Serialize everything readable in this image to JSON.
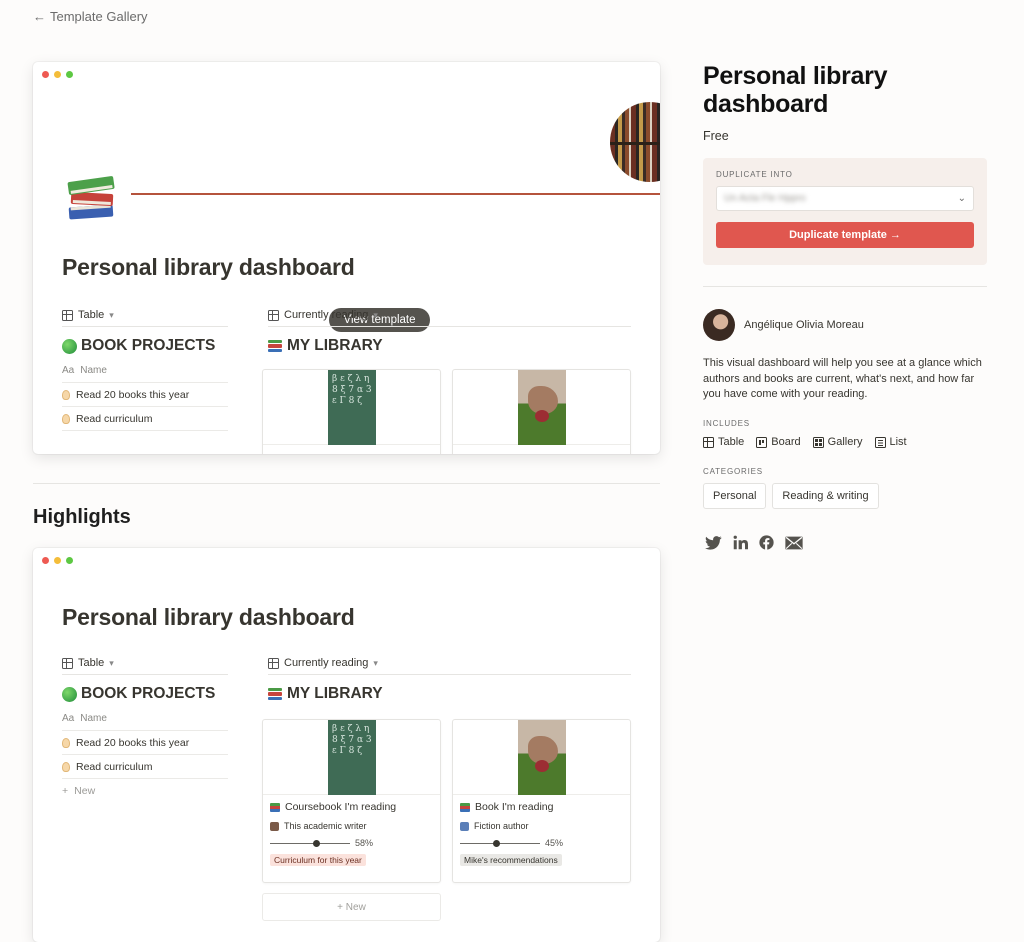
{
  "nav": {
    "back_label": "Template Gallery"
  },
  "preview": {
    "page_title": "Personal library dashboard",
    "view_template_label": "View template",
    "table_view_label": "Table",
    "gallery_view_label": "Currently reading",
    "book_projects_title": "BOOK PROJECTS",
    "my_library_title": "MY LIBRARY",
    "name_header": "Name",
    "rows": [
      "Read 20 books this year",
      "Read curriculum"
    ],
    "new_label": "New",
    "cards": [
      {
        "title": "Coursebook I'm reading",
        "author": "This academic writer",
        "progress": 58,
        "progress_label": "58%",
        "tag": "Curriculum for this year",
        "tag_color": "#fbe2dc"
      },
      {
        "title": "Book I'm reading",
        "author": "Fiction author",
        "progress": 45,
        "progress_label": "45%",
        "tag": "Mike's recommendations",
        "tag_color": "#e9e8e5"
      }
    ],
    "chalk_text": "β ε ζ λ η 8 ξ 7 α 3 ε Γ 8 ζ"
  },
  "highlights_label": "Highlights",
  "sidebar": {
    "title": "Personal library dashboard",
    "price": "Free",
    "duplicate_into_label": "DUPLICATE INTO",
    "duplicate_select_value": "Un Acta Fle Hppro",
    "duplicate_button": "Duplicate template →",
    "author_name": "Angélique Olivia Moreau",
    "description": "This visual dashboard will help you see at a glance which authors and books are current, what's next, and how far you have come with your reading.",
    "includes_label": "INCLUDES",
    "includes": [
      "Table",
      "Board",
      "Gallery",
      "List"
    ],
    "categories_label": "CATEGORIES",
    "categories": [
      "Personal",
      "Reading & writing"
    ]
  },
  "colors": {
    "accent": "#e0574f",
    "duplicate_bg": "#f6efeb",
    "cover_line": "#b5533c"
  }
}
